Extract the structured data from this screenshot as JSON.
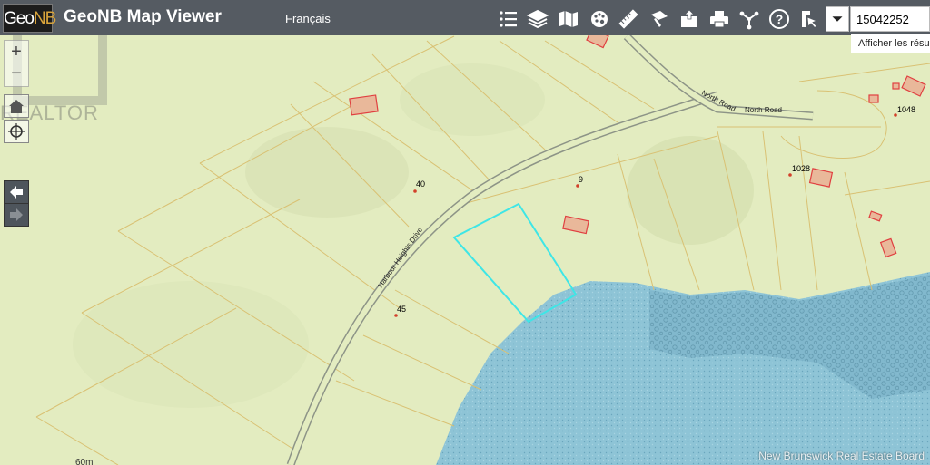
{
  "app": {
    "logo_text_a": "Geo",
    "logo_text_b": "NB",
    "title": "GeoNB Map Viewer",
    "language_link": "Français"
  },
  "toolbar": {
    "tools": [
      {
        "name": "legend-icon"
      },
      {
        "name": "layers-icon"
      },
      {
        "name": "basemap-icon"
      },
      {
        "name": "palette-icon"
      },
      {
        "name": "measure-icon"
      },
      {
        "name": "draw-icon"
      },
      {
        "name": "upload-icon"
      },
      {
        "name": "print-icon"
      },
      {
        "name": "share-icon"
      },
      {
        "name": "help-icon"
      },
      {
        "name": "identify-icon"
      }
    ]
  },
  "search": {
    "value": "15042252",
    "hint": "Afficher les résult"
  },
  "map": {
    "labels": {
      "road_harbour": "Harbour Heights Drive",
      "road_north_a": "North Road",
      "road_north_b": "North Road",
      "p40": "40",
      "p9": "9",
      "p45": "45",
      "p1048": "1048",
      "p1028": "1028",
      "elev": "60m"
    }
  },
  "watermark": {
    "realtor": "REALTOR",
    "board": "New Brunswick Real Estate Board"
  },
  "colors": {
    "land": "#e3ecc0",
    "water": "#8ec4d6",
    "parcel_line": "#d9c173",
    "building": "#e04040",
    "highlight": "#3ee6e6",
    "toolbar": "#555b62"
  }
}
